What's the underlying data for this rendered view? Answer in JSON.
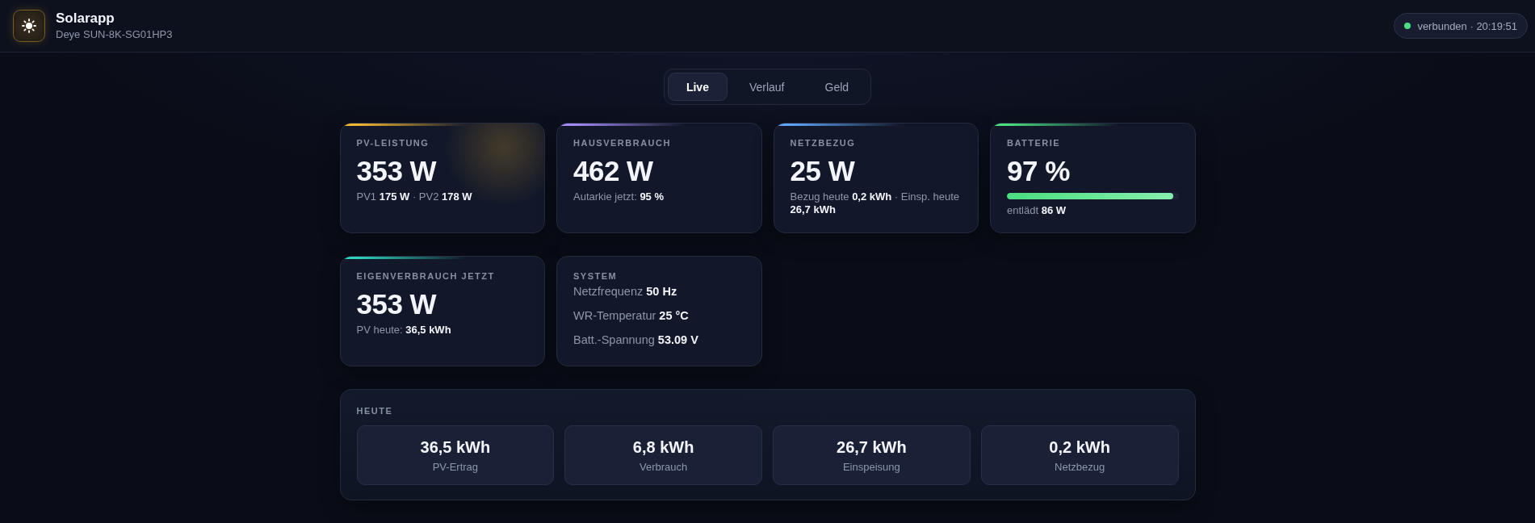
{
  "header": {
    "app_name": "Solarapp",
    "device": "Deye SUN-8K-SG01HP3",
    "status": {
      "connected": true,
      "text": "verbunden · 20:19:51"
    }
  },
  "tabs": [
    {
      "label": "Live",
      "selected": true
    },
    {
      "label": "Verlauf",
      "selected": false
    },
    {
      "label": "Geld",
      "selected": false
    }
  ],
  "cards": [
    {
      "kind": "metric",
      "title": "PV-LEISTUNG",
      "value": "353 W",
      "detail": "PV1 **175 W** · PV2 **178 W**",
      "color": "#f5b731",
      "glow": true
    },
    {
      "kind": "metric",
      "title": "HAUSVERBRAUCH",
      "value": "462 W",
      "detail": "Autarkie jetzt: **95 %**",
      "color": "#a78bfa",
      "glow": false
    },
    {
      "kind": "metric",
      "title": "NETZBEZUG",
      "value": "25 W",
      "detail": "Bezug heute **0,2 kWh** · Einsp. heute **26,7 kWh**",
      "color": "#60a5fa",
      "glow": false
    },
    {
      "kind": "battery",
      "title": "BATTERIE",
      "value": "97 %",
      "level": 0.97,
      "detail": "entlädt **86 W**",
      "color": "#4ade80",
      "glow": false
    },
    {
      "kind": "metric",
      "title": "EIGENVERBRAUCH JETZT",
      "value": "353 W",
      "detail": "PV heute: **36,5 kWh**",
      "color": "#2dd4bf",
      "glow": false
    },
    {
      "kind": "list",
      "title": "SYSTEM",
      "rows": [
        "Netzfrequenz **50 Hz**",
        "WR-Temperatur **25 °C**",
        "Batt.-Spannung **53.09 V**"
      ]
    }
  ],
  "today": {
    "title": "HEUTE",
    "items": [
      {
        "value": "36,5 kWh",
        "label": "PV-Ertrag"
      },
      {
        "value": "6,8 kWh",
        "label": "Verbrauch"
      },
      {
        "value": "26,7 kWh",
        "label": "Einspeisung"
      },
      {
        "value": "0,2 kWh",
        "label": "Netzbezug"
      }
    ]
  }
}
